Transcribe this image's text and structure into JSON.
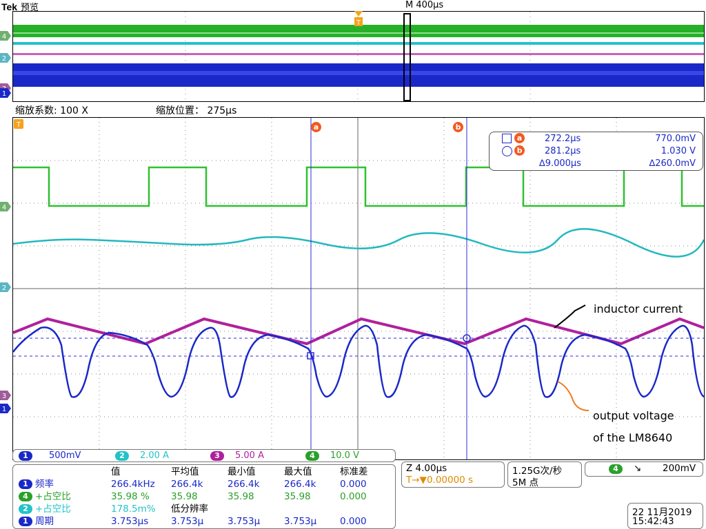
{
  "header": {
    "brand": "Tek",
    "mode": "预览"
  },
  "timebase": {
    "label": "M 400µs"
  },
  "zoom": {
    "factor_label": "缩放系数: 100 X",
    "position_label": "缩放位置： 275µs"
  },
  "trigger_marker": "T",
  "channel_markers": [
    "4",
    "2",
    "3",
    "1"
  ],
  "cursors": {
    "a": {
      "label": "a",
      "time": "272.2µs",
      "value": "770.0mV"
    },
    "b": {
      "label": "b",
      "time": "281.2µs",
      "value": "1.030 V"
    },
    "delta_time": "∆9.000µs",
    "delta_value": "∆260.0mV"
  },
  "annotations": {
    "inductor": "inductor current",
    "output_line1": "output voltage",
    "output_line2": "of the LM8640"
  },
  "channels": [
    {
      "num": "1",
      "scale": "500mV",
      "color": "#1a28c8"
    },
    {
      "num": "2",
      "scale": "2.00 A",
      "color": "#22c3c8"
    },
    {
      "num": "3",
      "scale": "5.00 A",
      "color": "#b0209c"
    },
    {
      "num": "4",
      "scale": "10.0 V",
      "color": "#2aa02a"
    }
  ],
  "measurements": {
    "headers": [
      "值",
      "平均值",
      "最小值",
      "最大值",
      "标准差"
    ],
    "rows": [
      {
        "ch": "1",
        "name": "频率",
        "value": "266.4kHz",
        "mean": "266.4k",
        "min": "266.4k",
        "max": "266.4k",
        "std": "0.000"
      },
      {
        "ch": "4",
        "name": "+占空比",
        "value": "35.98 %",
        "mean": "35.98",
        "min": "35.98",
        "max": "35.98",
        "std": "0.000"
      },
      {
        "ch": "2",
        "name": "+占空比",
        "value": "178.5m%",
        "mean": "低分辨率",
        "min": "",
        "max": "",
        "std": ""
      },
      {
        "ch": "1",
        "name": "周期",
        "value": "3.753µs",
        "mean": "3.753µ",
        "min": "3.753µ",
        "max": "3.753µ",
        "std": "0.000"
      }
    ]
  },
  "horizontal": {
    "zoom_scale": "Z 4.00µs",
    "trigger_pos": "T→▼0.00000 s"
  },
  "acquisition": {
    "rate": "1.25G次/秒",
    "points": "5M 点"
  },
  "trigger": {
    "channel": "4",
    "slope": "↘",
    "level": "200mV"
  },
  "datetime": {
    "date": "22 11月2019",
    "time": "15:42:43"
  }
}
